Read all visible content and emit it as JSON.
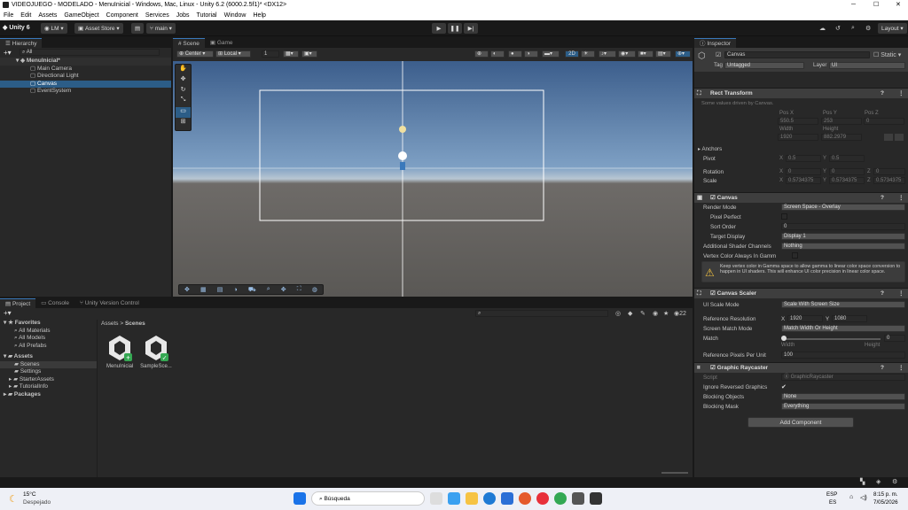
{
  "window": {
    "title": "VIDEOJUEGO - MODELADO - MenuInicial - Windows, Mac, Linux - Unity 6.2 (6000.2.5f1)* <DX12>"
  },
  "menu": [
    "File",
    "Edit",
    "Assets",
    "GameObject",
    "Component",
    "Services",
    "Jobs",
    "Tutorial",
    "Window",
    "Help"
  ],
  "toolbar": {
    "unity": "Unity 6",
    "account": "LM",
    "store": "Asset Store",
    "branch": "main",
    "layout": "Layout"
  },
  "hierarchy": {
    "tab": "Hierarchy",
    "search": "All",
    "scene": "MenuInicial*",
    "items": [
      "Main Camera",
      "Directional Light",
      "Canvas",
      "EventSystem"
    ]
  },
  "scene": {
    "tab_scene": "Scene",
    "tab_game": "Game",
    "pivot": "Center",
    "space": "Local",
    "snap": "1",
    "mode2d": "2D"
  },
  "project": {
    "tab": "Project",
    "tab_console": "Console",
    "tab_vc": "Unity Version Control",
    "favorites": "Favorites",
    "fav_items": [
      "All Materials",
      "All Models",
      "All Prefabs"
    ],
    "assets": "Assets",
    "asset_children": [
      "Scenes",
      "Settings",
      "StarterAssets",
      "TutorialInfo"
    ],
    "packages": "Packages",
    "breadcrumb_root": "Assets",
    "breadcrumb_child": "Scenes",
    "files": [
      "MenuInicial",
      "SampleSce..."
    ],
    "count": "22"
  },
  "inspector": {
    "tab": "Inspector",
    "object": "Canvas",
    "static": "Static",
    "tag_label": "Tag",
    "tag": "Untagged",
    "layer_label": "Layer",
    "layer": "UI",
    "rect": {
      "title": "Rect Transform",
      "note": "Some values driven by Canvas.",
      "posx_l": "Pos X",
      "posy_l": "Pos Y",
      "posz_l": "Pos Z",
      "posx": "550.5",
      "posy": "253",
      "posz": "0",
      "w_l": "Width",
      "h_l": "Height",
      "w": "1920",
      "h": "882.2979",
      "anchors": "Anchors",
      "pivot": "Pivot",
      "pivx": "0.5",
      "pivy": "0.5",
      "rotation": "Rotation",
      "rx": "0",
      "ry": "0",
      "rz": "0",
      "scale": "Scale",
      "sx": "0.5734375",
      "sy": "0.5734375",
      "sz": "0.5734375"
    },
    "canvas": {
      "title": "Canvas",
      "render_mode_l": "Render Mode",
      "render_mode": "Screen Space - Overlay",
      "pixel_perfect_l": "Pixel Perfect",
      "sort_order_l": "Sort Order",
      "sort_order": "0",
      "target_display_l": "Target Display",
      "target_display": "Display 1",
      "shader_l": "Additional Shader Channels",
      "shader": "Nothing",
      "vertex_l": "Vertex Color Always In Gamm",
      "warning": "Keep vertex color in Gamma space to allow gamma to linear color space conversion to happen in UI shaders. This will enhance UI color precision in linear color space."
    },
    "scaler": {
      "title": "Canvas Scaler",
      "scale_mode_l": "UI Scale Mode",
      "scale_mode": "Scale With Screen Size",
      "ref_res_l": "Reference Resolution",
      "rx": "1920",
      "ry": "1080",
      "match_mode_l": "Screen Match Mode",
      "match_mode": "Match Width Or Height",
      "match_l": "Match",
      "match": "0",
      "width": "Width",
      "height": "Height",
      "ppu_l": "Reference Pixels Per Unit",
      "ppu": "100"
    },
    "raycaster": {
      "title": "Graphic Raycaster",
      "script_l": "Script",
      "script": "GraphicRaycaster",
      "ignore_l": "Ignore Reversed Graphics",
      "blocking_l": "Blocking Objects",
      "blocking": "None",
      "mask_l": "Blocking Mask",
      "mask": "Everything"
    },
    "add_component": "Add Component"
  },
  "taskbar": {
    "temp": "15°C",
    "weather": "Despejado",
    "search": "Búsqueda",
    "lang1": "ESP",
    "lang2": "ES",
    "time": "8:15 p. m.",
    "date": "7/05/2026"
  }
}
